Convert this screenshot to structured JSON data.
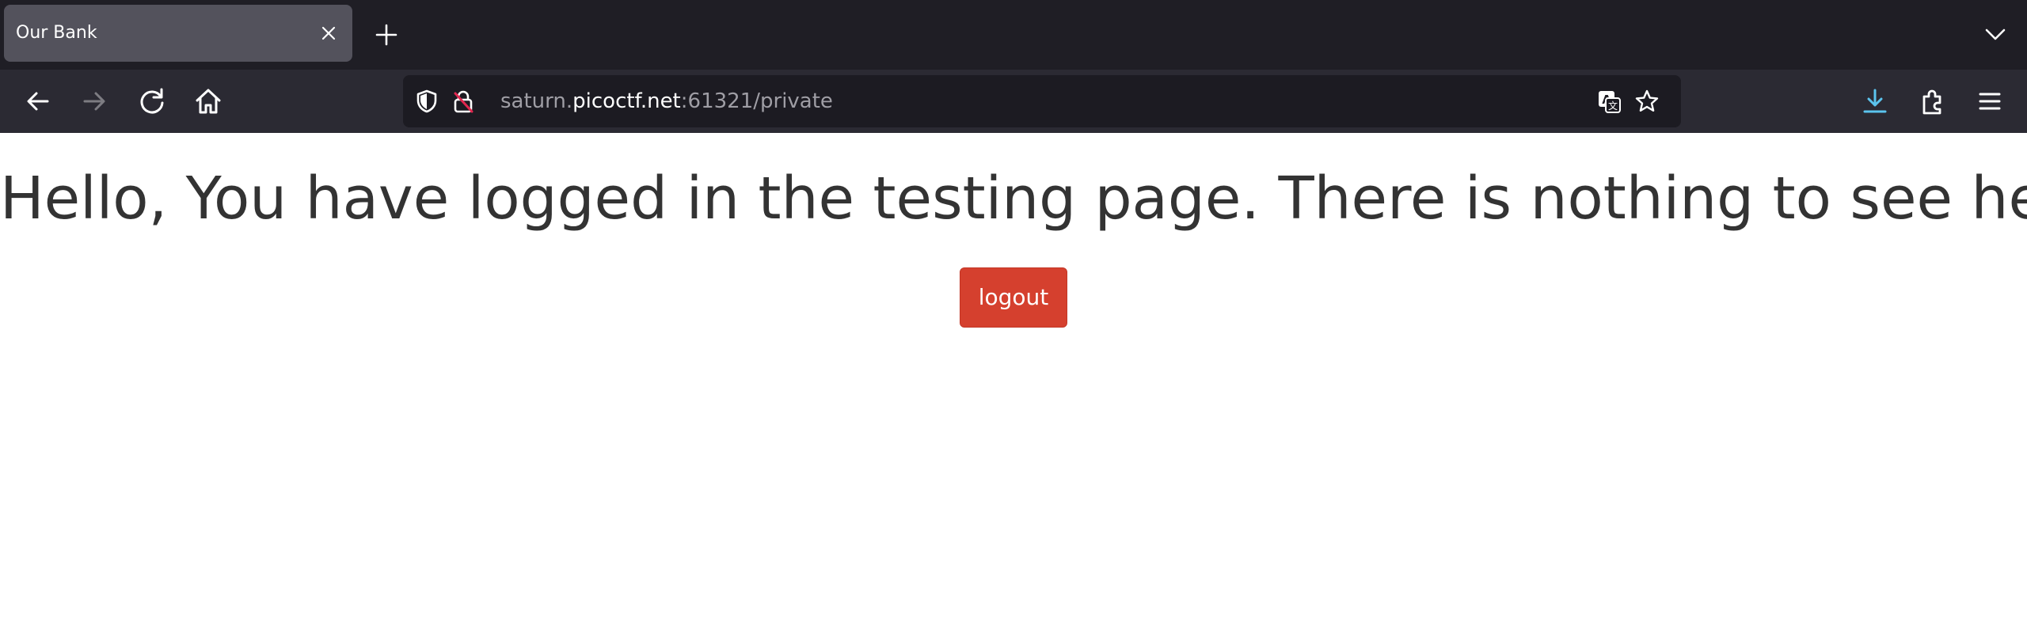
{
  "browser": {
    "tab": {
      "title": "Our Bank"
    },
    "address_bar": {
      "url_prefix": "saturn.",
      "url_host": "picoctf.net",
      "url_suffix": ":61321/private"
    },
    "icons": {
      "tab_close": "close-icon",
      "new_tab": "plus-icon",
      "tab_list": "chevron-down-icon",
      "back": "arrow-left-icon",
      "forward": "arrow-right-icon",
      "reload": "reload-icon",
      "home": "home-icon",
      "tracking": "shield-icon",
      "insecure": "lock-strikethrough-icon",
      "translate": "translate-icon",
      "bookmark": "star-icon",
      "downloads": "download-icon",
      "extensions": "puzzle-icon",
      "menu": "hamburger-menu-icon"
    },
    "colors": {
      "download_accent": "#5bc4ee",
      "insecure_strike": "#e22850"
    }
  },
  "page": {
    "heading": "Hello, You have logged in the testing page. There is nothing to see here.",
    "logout_label": "logout",
    "colors": {
      "logout_button": "#d5402e",
      "heading_text": "#333333"
    }
  }
}
